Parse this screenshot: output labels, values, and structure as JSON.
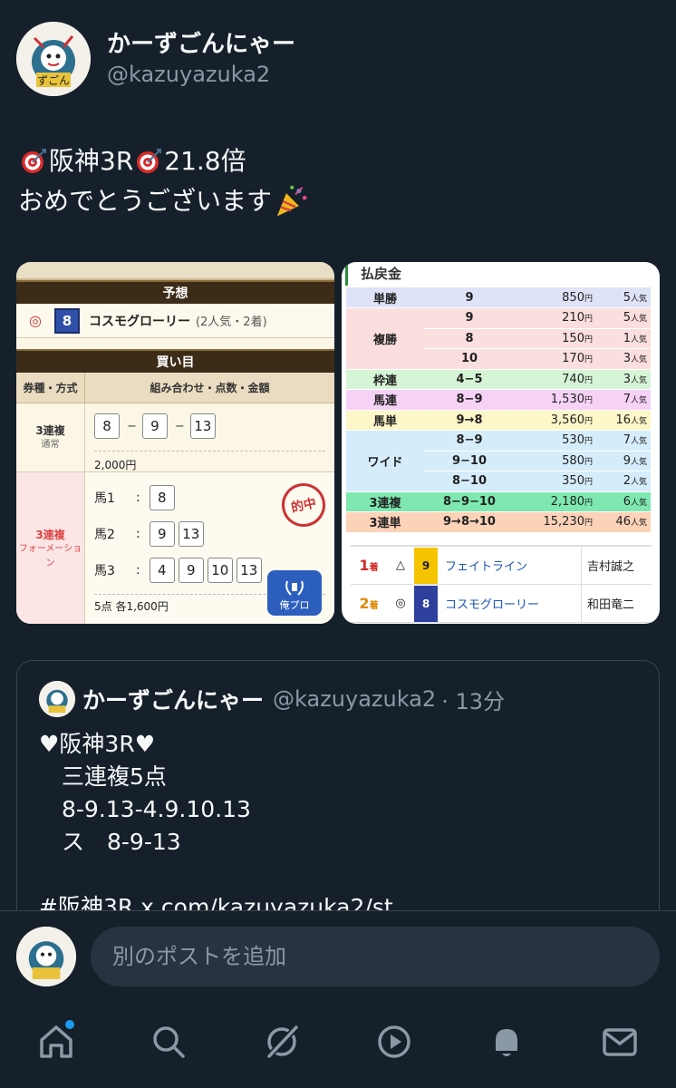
{
  "post": {
    "author_name": "かーずごんにゃー",
    "author_handle": "@kazuyazuka2",
    "line1_a": "阪神3R",
    "line1_b": "21.8倍",
    "line2": "おめでとうございます"
  },
  "left_image": {
    "band_top": "予想",
    "pick_mark": "◎",
    "pick_num": "8",
    "pick_name": "コスモグローリー",
    "pick_sub": "(2人気・2着)",
    "band_buy": "買い目",
    "head_type": "券種・方式",
    "head_combo": "組み合わせ・点数・金額",
    "row1_type": "3連複",
    "row1_sub": "通常",
    "row1_combo": [
      "8",
      "9",
      "13"
    ],
    "row1_amount": "2,000円",
    "row2_type": "3連複",
    "row2_sub": "フォーメーション",
    "row2_lines": [
      {
        "label": "馬1",
        "nums": [
          "8"
        ]
      },
      {
        "label": "馬2",
        "nums": [
          "9",
          "13"
        ]
      },
      {
        "label": "馬3",
        "nums": [
          "4",
          "9",
          "10",
          "13"
        ]
      }
    ],
    "row2_amount": "5点 各1,600円",
    "stamp": "的中",
    "badge": "俺プロ"
  },
  "right_image": {
    "title": "払戻金",
    "rows": [
      {
        "type": "単勝",
        "combo": "9",
        "pay": "850",
        "pop": "5",
        "bg": "#dfe3f7"
      },
      {
        "type": "複勝",
        "combo": "9",
        "pay": "210",
        "pop": "5",
        "bg": "#fbdede",
        "span": 3
      },
      {
        "type": "",
        "combo": "8",
        "pay": "150",
        "pop": "1",
        "bg": "#fbdede"
      },
      {
        "type": "",
        "combo": "10",
        "pay": "170",
        "pop": "3",
        "bg": "#fbdede"
      },
      {
        "type": "枠連",
        "combo": "4−5",
        "pay": "740",
        "pop": "3",
        "bg": "#d6f5d6"
      },
      {
        "type": "馬連",
        "combo": "8−9",
        "pay": "1,530",
        "pop": "7",
        "bg": "#f7d2f7"
      },
      {
        "type": "馬単",
        "combo": "9→8",
        "pay": "3,560",
        "pop": "16",
        "bg": "#fdf6c8"
      },
      {
        "type": "ワイド",
        "combo": "8−9",
        "pay": "530",
        "pop": "7",
        "bg": "#d5ecfb",
        "span": 3
      },
      {
        "type": "",
        "combo": "9−10",
        "pay": "580",
        "pop": "9",
        "bg": "#d5ecfb"
      },
      {
        "type": "",
        "combo": "8−10",
        "pay": "350",
        "pop": "2",
        "bg": "#d5ecfb"
      },
      {
        "type": "3連複",
        "combo": "8−9−10",
        "pay": "2,180",
        "pop": "6",
        "bg": "#7ee8b0"
      },
      {
        "type": "3連単",
        "combo": "9→8→10",
        "pay": "15,230",
        "pop": "46",
        "bg": "#fcd2b8"
      }
    ],
    "yen": "円",
    "popular": "人気",
    "results": [
      {
        "rank": "1",
        "rank_suffix": "着",
        "mark": "△",
        "num": "9",
        "waku_bg": "#f5c400",
        "waku_fg": "#222",
        "horse": "フェイトライン",
        "jockey": "吉村誠之",
        "rank_color": "#d42a2a"
      },
      {
        "rank": "2",
        "rank_suffix": "着",
        "mark": "◎",
        "num": "8",
        "waku_bg": "#2f3f9e",
        "waku_fg": "#fff",
        "horse": "コスモグローリー",
        "jockey": "和田竜二",
        "rank_color": "#e08a00"
      }
    ]
  },
  "quote": {
    "author_name": "かーずごんにゃー",
    "author_handle": "@kazuyazuka2",
    "time": "· 13分",
    "text": "♥阪神3R♥\n　三連複5点\n　8-9.13-4.9.10.13\n　ス　8-9-13\n\n#阪神3R x.com/kazuyazuka2/st"
  },
  "compose": {
    "placeholder": "別のポストを追加"
  },
  "nav": {
    "items": [
      "home-icon",
      "search-icon",
      "grok-icon",
      "video-icon",
      "notifications-icon",
      "messages-icon"
    ]
  }
}
